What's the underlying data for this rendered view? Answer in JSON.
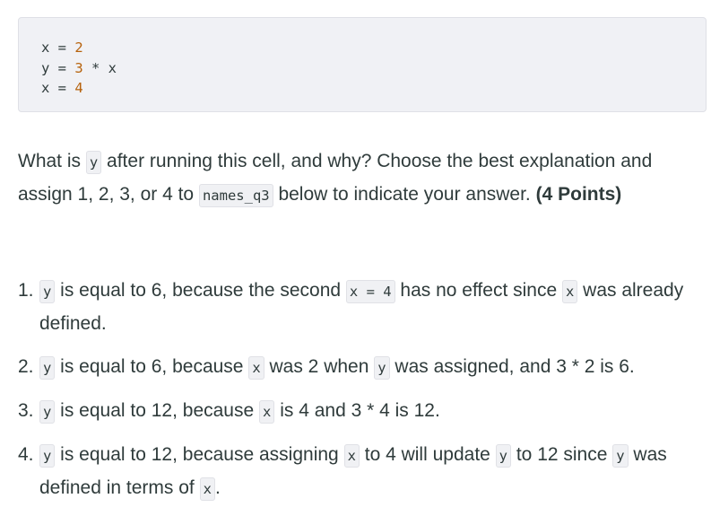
{
  "code": [
    [
      {
        "t": "x = "
      },
      {
        "n": "2"
      }
    ],
    [
      {
        "t": "y = "
      },
      {
        "n": "3"
      },
      {
        "t": " * x"
      }
    ],
    [
      {
        "t": "x = "
      },
      {
        "n": "4"
      }
    ]
  ],
  "question": [
    {
      "t": "What is "
    },
    {
      "c": "y"
    },
    {
      "t": " after running this cell, and why? Choose the best explanation and assign 1, 2, 3, or 4 to "
    },
    {
      "c": "names_q3"
    },
    {
      "t": " below to indicate your answer. "
    },
    {
      "b": "(4 Points)"
    }
  ],
  "options": [
    {
      "num": "1.",
      "parts": [
        {
          "c": "y"
        },
        {
          "t": " is equal to 6, because the second "
        },
        {
          "c": "x = 4"
        },
        {
          "t": " has no effect since "
        },
        {
          "c": "x"
        },
        {
          "t": " was already defined."
        }
      ]
    },
    {
      "num": "2.",
      "parts": [
        {
          "c": "y"
        },
        {
          "t": " is equal to 6, because "
        },
        {
          "c": "x"
        },
        {
          "t": " was 2 when "
        },
        {
          "c": "y"
        },
        {
          "t": " was assigned, and 3 * 2 is 6."
        }
      ]
    },
    {
      "num": "3.",
      "parts": [
        {
          "c": "y"
        },
        {
          "t": " is equal to 12, because "
        },
        {
          "c": "x"
        },
        {
          "t": " is 4 and 3 * 4 is 12."
        }
      ]
    },
    {
      "num": "4.",
      "parts": [
        {
          "c": "y"
        },
        {
          "t": " is equal to 12, because assigning "
        },
        {
          "c": "x"
        },
        {
          "t": " to 4 will update "
        },
        {
          "c": "y"
        },
        {
          "t": " to 12 since "
        },
        {
          "c": "y"
        },
        {
          "t": " was defined in terms of "
        },
        {
          "c": "x"
        },
        {
          "t": "."
        }
      ]
    }
  ],
  "colors": {
    "code_bg": "#f0f1f5",
    "number": "#b6620c",
    "text": "#2f3b3b"
  }
}
